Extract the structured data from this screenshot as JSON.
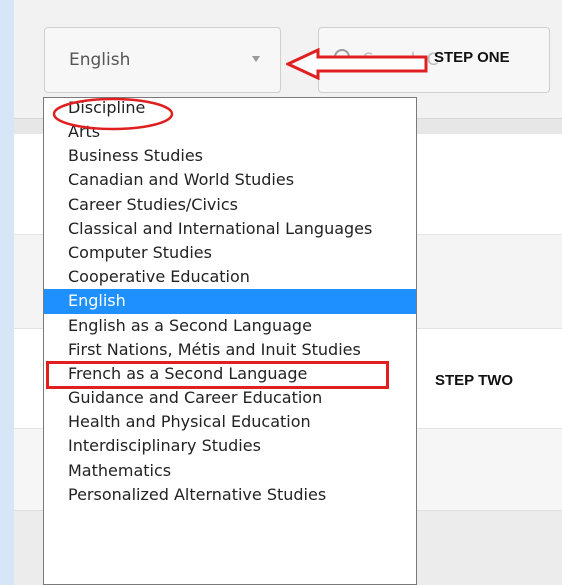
{
  "filters": {
    "discipline_select": {
      "value": "English"
    },
    "search": {
      "placeholder": "Search C"
    }
  },
  "annotations": {
    "step_one": "STEP ONE",
    "step_two": "STEP TWO",
    "highlight_color": "#e02020"
  },
  "dropdown": {
    "selected": "English",
    "selected_color": "#1e90ff",
    "items": [
      "Discipline",
      "Arts",
      "Business Studies",
      "Canadian and World Studies",
      "Career Studies/Civics",
      "Classical and International Languages",
      "Computer Studies",
      "Cooperative Education",
      "English",
      "English as a Second Language",
      "First Nations, Métis and Inuit Studies",
      "French as a Second Language",
      "Guidance and Career Education",
      "Health and Physical Education",
      "Interdisciplinary Studies",
      "Mathematics",
      "Personalized Alternative Studies"
    ]
  }
}
